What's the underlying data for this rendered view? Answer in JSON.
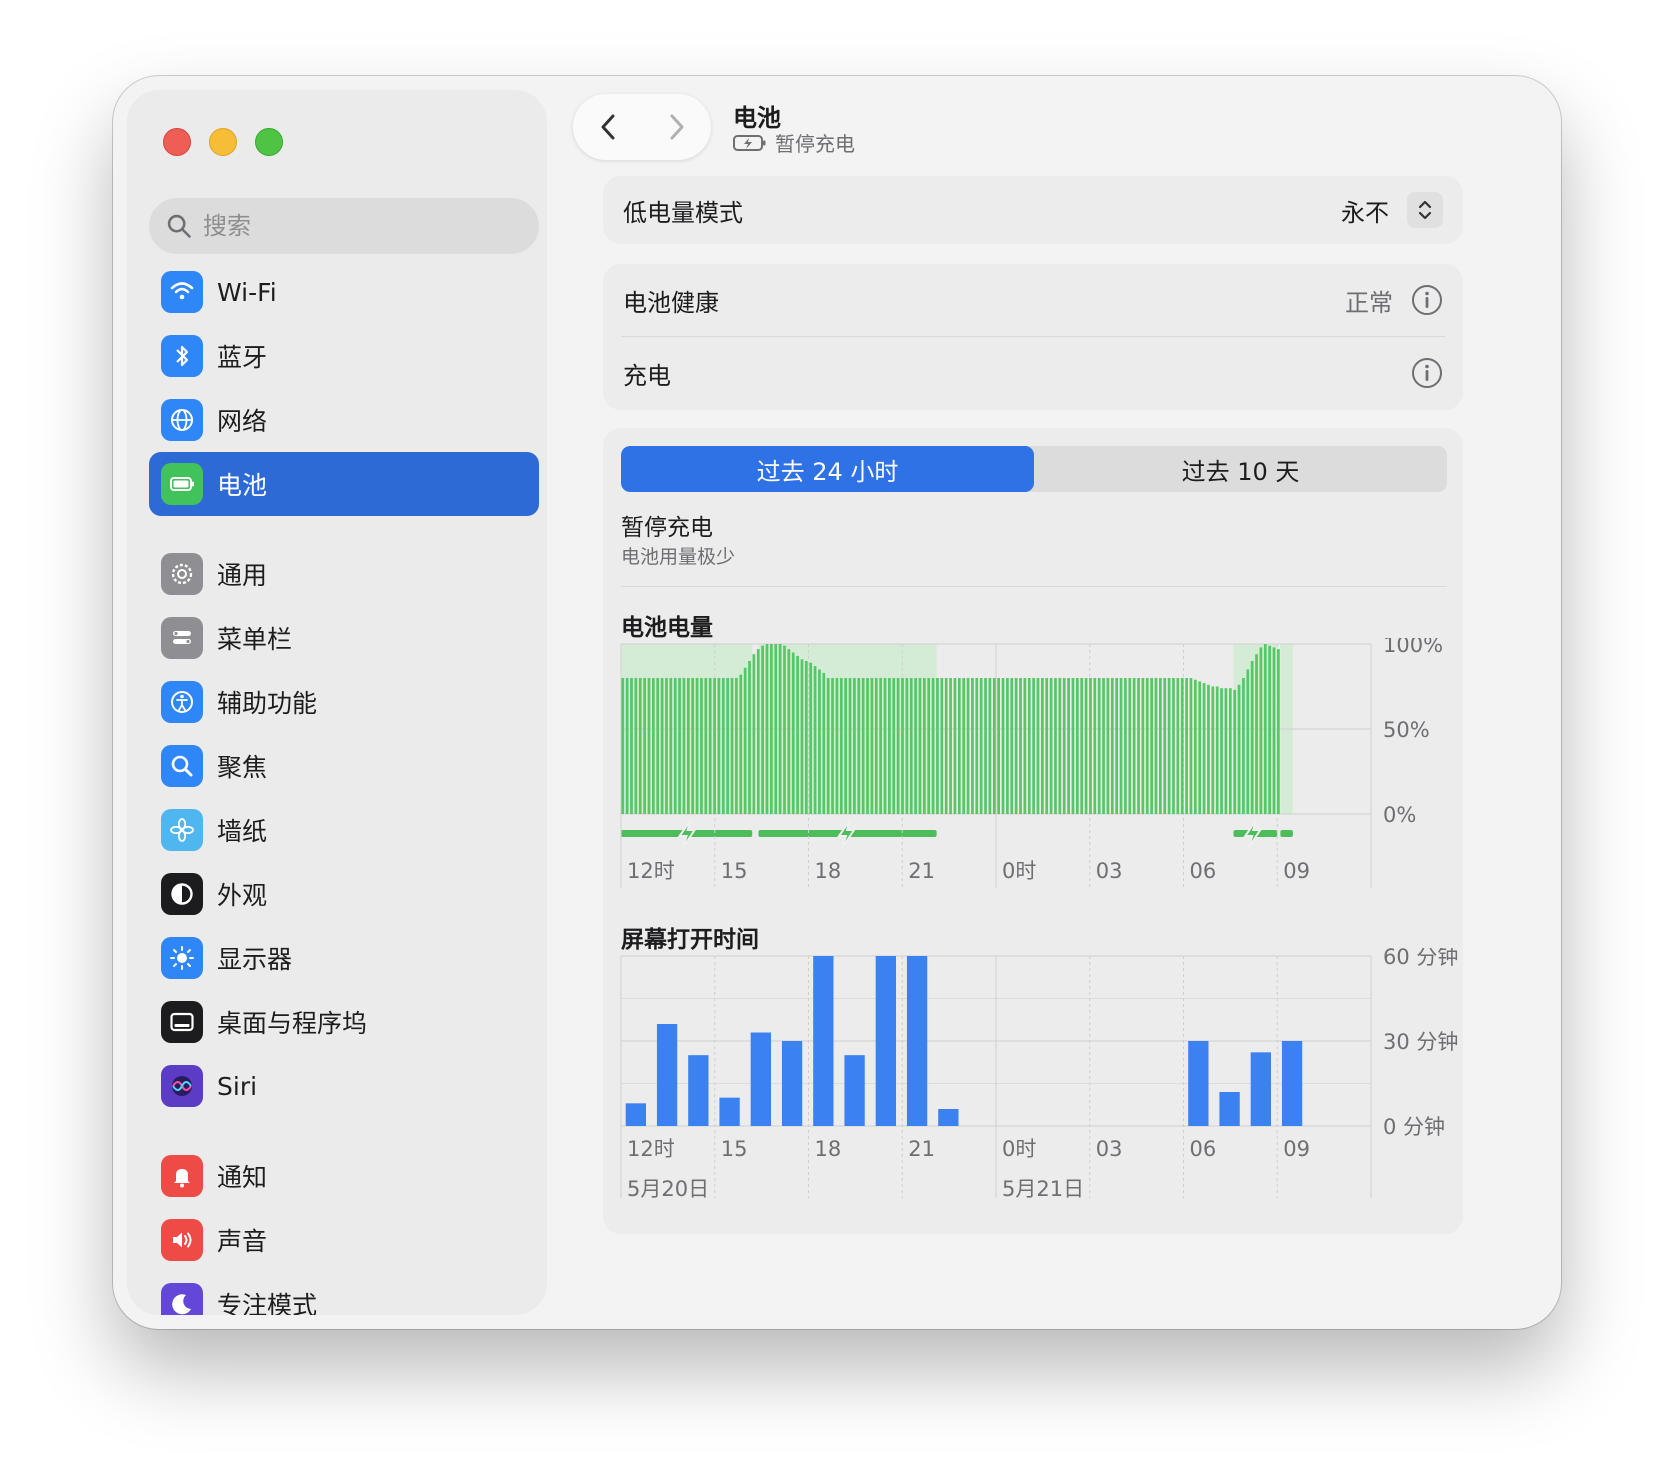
{
  "window": {
    "title": "电池",
    "subtitle": "暂停充电"
  },
  "search": {
    "placeholder": "搜索"
  },
  "sidebar": {
    "groups": [
      [
        {
          "label": "Wi-Fi",
          "icon": "wifi-icon",
          "color": "#2f86f6"
        },
        {
          "label": "蓝牙",
          "icon": "bluetooth-icon",
          "color": "#2f86f6"
        },
        {
          "label": "网络",
          "icon": "globe-icon",
          "color": "#2f86f6"
        },
        {
          "label": "电池",
          "icon": "battery-icon",
          "color": "#42c25a",
          "active": true
        }
      ],
      [
        {
          "label": "通用",
          "icon": "gear-icon",
          "color": "#8e8e93"
        },
        {
          "label": "菜单栏",
          "icon": "menubar-icon",
          "color": "#8e8e93"
        },
        {
          "label": "辅助功能",
          "icon": "accessibility-icon",
          "color": "#2f86f6"
        },
        {
          "label": "聚焦",
          "icon": "magnifier-icon",
          "color": "#2f86f6"
        },
        {
          "label": "墙纸",
          "icon": "flower-icon",
          "color": "#4fb6ef"
        },
        {
          "label": "外观",
          "icon": "appearance-icon",
          "color": "#1c1c1e"
        },
        {
          "label": "显示器",
          "icon": "sun-icon",
          "color": "#2f86f6"
        },
        {
          "label": "桌面与程序坞",
          "icon": "dock-icon",
          "color": "#1c1c1e"
        },
        {
          "label": "Siri",
          "icon": "siri-icon",
          "color": "#5b3cc4"
        }
      ],
      [
        {
          "label": "通知",
          "icon": "bell-icon",
          "color": "#ee4b47"
        },
        {
          "label": "声音",
          "icon": "speaker-icon",
          "color": "#ee4b47"
        },
        {
          "label": "专注模式",
          "icon": "moon-icon",
          "color": "#6247d8"
        }
      ]
    ]
  },
  "low_power": {
    "label": "低电量模式",
    "value": "永不"
  },
  "battery_health": {
    "label": "电池健康",
    "value": "正常"
  },
  "charging": {
    "label": "充电"
  },
  "tabs": [
    {
      "label": "过去 24 小时",
      "selected": true
    },
    {
      "label": "过去 10 天",
      "selected": false
    }
  ],
  "status": {
    "title": "暂停充电",
    "detail": "电池用量极少"
  },
  "battery_chart": {
    "title": "电池电量",
    "y_ticks": [
      "100%",
      "50%",
      "0%"
    ],
    "x_ticks": [
      "12时",
      "15",
      "18",
      "21",
      "0时",
      "03",
      "06",
      "09"
    ]
  },
  "screen_chart": {
    "title": "屏幕打开时间",
    "y_ticks": [
      "60 分钟",
      "30 分钟",
      "0 分钟"
    ],
    "x_ticks": [
      "12时",
      "15",
      "18",
      "21",
      "0时",
      "03",
      "06",
      "09"
    ],
    "dates": [
      "5月20日",
      "5月21日"
    ]
  },
  "chart_data": [
    {
      "type": "bar",
      "title": "电池电量",
      "ylim": [
        0,
        100
      ],
      "x_range_hours": [
        0,
        24
      ],
      "charging_ranges": [
        [
          0,
          4.2
        ],
        [
          4.4,
          10.1
        ],
        [
          19.6,
          21.0
        ],
        [
          21.1,
          21.5
        ]
      ],
      "values": [
        80,
        80,
        80,
        80,
        80,
        80,
        80,
        80,
        80,
        80,
        80,
        80,
        80,
        80,
        80,
        80,
        80,
        80,
        80,
        80,
        80,
        80,
        80,
        80,
        80,
        80,
        80,
        82,
        86,
        90,
        94,
        97,
        99,
        100,
        100,
        100,
        100,
        99,
        97,
        95,
        93,
        91,
        90,
        89,
        87,
        85,
        83,
        80,
        80,
        80,
        80,
        80,
        80,
        80,
        80,
        80,
        80,
        80,
        80,
        80,
        80,
        80,
        80,
        80,
        80,
        80,
        80,
        80,
        80,
        80,
        80,
        80,
        80,
        80,
        80,
        80,
        80,
        80,
        80,
        80,
        80,
        80,
        80,
        80,
        80,
        80,
        80,
        80,
        80,
        80,
        80,
        80,
        80,
        80,
        80,
        80,
        80,
        80,
        80,
        80,
        80,
        80,
        80,
        80,
        80,
        80,
        80,
        80,
        80,
        80,
        80,
        80,
        80,
        80,
        80,
        80,
        80,
        80,
        80,
        80,
        80,
        80,
        80,
        80,
        80,
        80,
        80,
        80,
        80,
        80,
        80,
        79,
        78,
        77,
        76,
        75,
        75,
        74,
        74,
        74,
        73,
        76,
        80,
        85,
        90,
        94,
        98,
        100,
        99,
        98,
        97
      ]
    },
    {
      "type": "bar",
      "title": "屏幕打开时间",
      "ylim": [
        0,
        60
      ],
      "x": [
        0,
        1,
        2,
        3,
        4,
        5,
        6,
        7,
        8,
        9,
        10,
        11,
        12,
        13,
        14,
        15,
        16,
        17,
        18,
        19,
        20,
        21,
        22,
        23
      ],
      "values": [
        8,
        36,
        25,
        10,
        33,
        30,
        60,
        25,
        60,
        60,
        6,
        0,
        0,
        0,
        0,
        0,
        0,
        0,
        30,
        12,
        26,
        30,
        0,
        0
      ]
    }
  ]
}
